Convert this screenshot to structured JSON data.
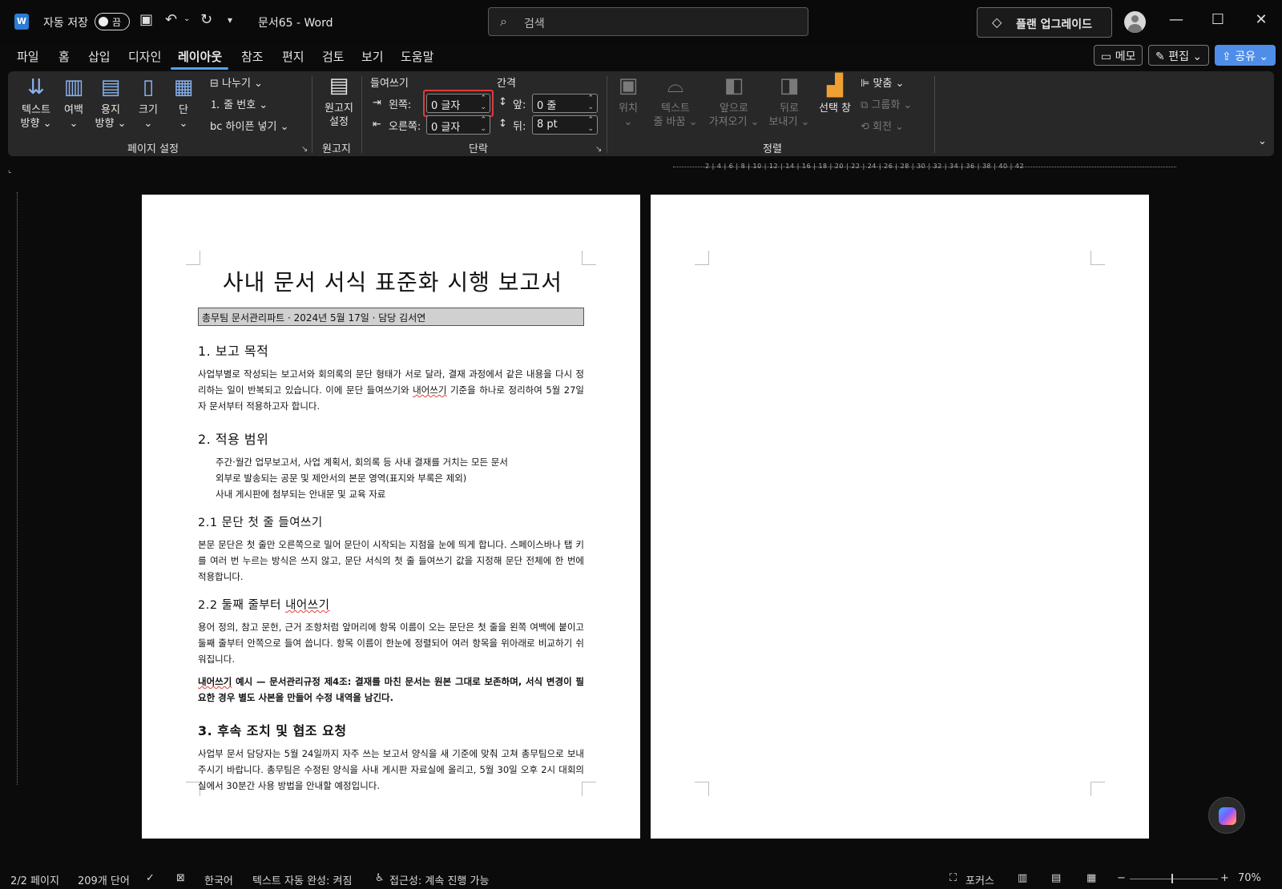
{
  "titlebar": {
    "autosave_label": "자동 저장",
    "autosave_state": "끔",
    "doc_title": "문서65  -  Word",
    "search_placeholder": "검색",
    "upgrade_label": "플랜 업그레이드"
  },
  "tabs": [
    "파일",
    "홈",
    "삽입",
    "디자인",
    "레이아웃",
    "참조",
    "편지",
    "검토",
    "보기",
    "도움말"
  ],
  "active_tab": "레이아웃",
  "right_buttons": {
    "memo": "메모",
    "edit": "편집",
    "share": "공유"
  },
  "ribbon": {
    "page_setup": {
      "text_direction": [
        "텍스트",
        "방향 ⌄"
      ],
      "margins": [
        "여백",
        "⌄"
      ],
      "orientation": [
        "용지",
        "방향 ⌄"
      ],
      "size": [
        "크기",
        "⌄"
      ],
      "columns": [
        "단",
        "⌄"
      ],
      "breaks": "나누기 ⌄",
      "line_numbers": "줄 번호 ⌄",
      "hyphenation": "하이픈 넣기 ⌄",
      "group_label": "페이지 설정"
    },
    "manuscript": {
      "button": [
        "원고지",
        "설정"
      ],
      "group_label": "원고지"
    },
    "paragraph": {
      "indent_header": "들여쓰기",
      "spacing_header": "간격",
      "left_label": "왼쪽:",
      "left_value": "0 글자",
      "right_label": "오른쪽:",
      "right_value": "0 글자",
      "before_label": "앞:",
      "before_value": "0 줄",
      "after_label": "뒤:",
      "after_value": "8 pt",
      "group_label": "단락"
    },
    "arrange": {
      "position": [
        "위치",
        "⌄"
      ],
      "wrap_text": [
        "텍스트",
        "줄 바꿈 ⌄"
      ],
      "bring_forward": [
        "앞으로",
        "가져오기 ⌄"
      ],
      "send_backward": [
        "뒤로",
        "보내기 ⌄"
      ],
      "selection_pane": "선택 창",
      "align": "맞춤 ⌄",
      "group": "그룹화 ⌄",
      "rotate": "회전 ⌄",
      "group_label": "정렬"
    }
  },
  "ruler_numbers": "2 | 4 | 6 | 8 | 10 | 12 | 14 | 16 | 18 | 20 | 22 | 24 | 26 | 28 | 30 | 32 | 34 | 36 | 38 | 40 | 42",
  "document": {
    "title": "사내 문서 서식 표준화 시행 보고서",
    "meta": "총무팀 문서관리파트 · 2024년 5월 17일 · 담당 김서연",
    "s1_heading": "1. 보고 목적",
    "s1_para_a": "사업부별로 작성되는 보고서와 회의록의 문단 형태가 서로 달라, 결재 과정에서 같은 내용을 다시 정리하는 일이 반복되고 있습니다. 이에 문단 들여쓰기와 ",
    "s1_para_squig": "내어쓰기",
    "s1_para_b": " 기준을 하나로 정리하여 5월 27일자 문서부터 적용하고자 합니다.",
    "s2_heading": "2. 적용 범위",
    "s2_items": [
      "주간·월간 업무보고서, 사업 계획서, 회의록 등 사내 결재를 거치는 모든 문서",
      "외부로 발송되는 공문 및 제안서의 본문 영역(표지와 부록은 제외)",
      "사내 게시판에 첨부되는 안내문 및 교육 자료"
    ],
    "s21_heading": "2.1 문단 첫 줄 들여쓰기",
    "s21_para": "본문 문단은 첫 줄만 오른쪽으로 밀어 문단이 시작되는 지점을 눈에 띄게 합니다. 스페이스바나 탭 키를 여러 번 누르는 방식은 쓰지 않고, 문단 서식의 첫 줄 들여쓰기 값을 지정해 문단 전체에 한 번에 적용합니다.",
    "s22_heading_a": "2.2 둘째 줄부터 ",
    "s22_heading_squig": "내어쓰기",
    "s22_para": "용어 정의, 참고 문헌, 근거 조항처럼 앞머리에 항목 이름이 오는 문단은 첫 줄을 왼쪽 여백에 붙이고 둘째 줄부터 안쪽으로 들여 씁니다. 항목 이름이 한눈에 정렬되어 여러 항목을 위아래로 비교하기 쉬워집니다.",
    "s22_example_squig": "내어쓰기",
    "s22_example": " 예시 — 문서관리규정 제4조: 결재를 마친 문서는 원본 그대로 보존하며, 서식 변경이 필요한 경우 별도 사본을 만들어 수정 내역을 남긴다.",
    "s3_heading": "3. 후속 조치 및 협조 요청",
    "s3_para": "사업부 문서 담당자는 5월 24일까지 자주 쓰는 보고서 양식을 새 기준에 맞춰 고쳐 총무팀으로 보내 주시기 바랍니다. 총무팀은 수정된 양식을 사내 게시판 자료실에 올리고, 5월 30일 오후 2시 대회의실에서 30분간 사용 방법을 안내할 예정입니다."
  },
  "statusbar": {
    "page": "2/2 페이지",
    "words": "209개 단어",
    "language": "한국어",
    "autocomplete": "텍스트 자동 완성: 켜짐",
    "accessibility": "접근성: 계속 진행 가능",
    "focus": "포커스",
    "zoom": "70%"
  },
  "colors": {
    "accent": "#4ea3ff",
    "highlight": "#e03b3b",
    "share": "#4f8ee8"
  }
}
